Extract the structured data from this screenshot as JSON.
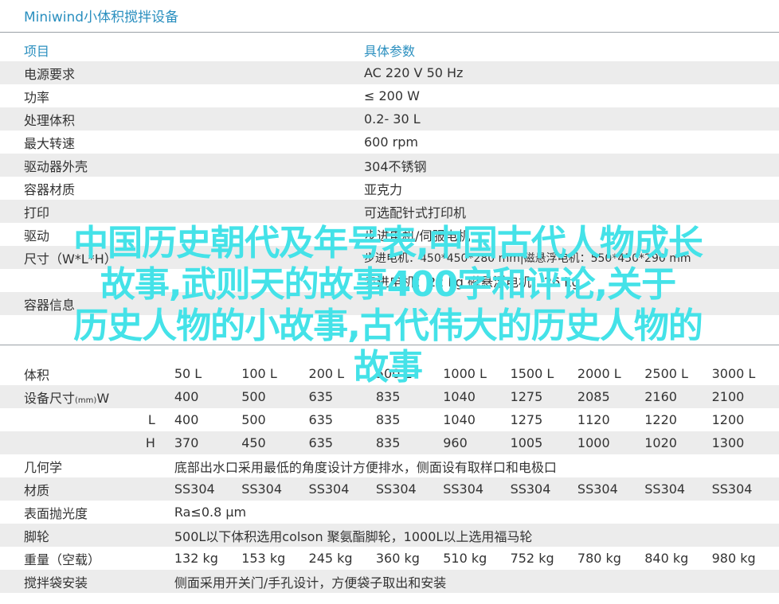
{
  "header": {
    "title": "Miniwind小体积搅拌设备"
  },
  "spec_table": {
    "headers": [
      "项目",
      "具体参数"
    ],
    "rows": [
      [
        "电源要求",
        "AC 220  V 50 Hz"
      ],
      [
        "功率",
        "≤ 200 W"
      ],
      [
        "处理体积",
        "0.2- 30 L"
      ],
      [
        "最大转速",
        "600  rpm"
      ],
      [
        "驱动器外壳",
        "304不锈钢"
      ],
      [
        "容器材质",
        "亚克力"
      ],
      [
        "打印",
        "可选配针式打印机"
      ]
    ],
    "partial_rows": [
      [
        "驱动",
        "步进电机/伺服电机"
      ],
      [
        "尺寸（W*L*H）",
        "步进电机：450*450*280 mm|磁悬浮电机：550*450*290 mm"
      ],
      [
        "",
        "步进电机：22 kg 磁悬浮电机：26 kg"
      ]
    ]
  },
  "section_label": "容器信息",
  "container_table": {
    "volume_label": "体积",
    "volumes": [
      "50 L",
      "100 L",
      "200 L",
      "500 L",
      "1000 L",
      "1500 L",
      "2000 L",
      "2500 L",
      "3000 L"
    ],
    "size_label": "设备尺寸",
    "size_unit": "(mm)",
    "W": {
      "label": "W",
      "values": [
        "400",
        "500",
        "635",
        "835",
        "1040",
        "1275",
        "2085",
        "2160",
        "2100"
      ]
    },
    "L": {
      "label": "L",
      "values": [
        "400",
        "500",
        "635",
        "835",
        "1040",
        "1275",
        "1120",
        "1220",
        "1200"
      ]
    },
    "H": {
      "label": "H",
      "values": [
        "370",
        "450",
        "635",
        "835",
        "960",
        "1005",
        "1000",
        "1020",
        "1300"
      ]
    },
    "geometry_label": "几何学",
    "geometry_value": "底部出水口采用最低的角度设计方便排水，侧面设有取样口和电极口",
    "material_label": "材质",
    "materials": [
      "SS304",
      "SS304",
      "SS304",
      "SS304",
      "SS304",
      "SS304",
      "SS304",
      "SS304",
      "SS304"
    ],
    "polish_label": "表面抛光度",
    "polish_value": "Ra≤0.8 μm",
    "wheel_label": "脚轮",
    "wheel_value": "500L以下体积选用colson 聚氨酯脚轮，1000L以上选用福马轮",
    "weight_label": "重量（空载）",
    "weights": [
      "132 kg",
      "153 kg",
      "245 kg",
      "360 kg",
      "510 kg",
      "752 kg",
      "780 kg",
      "840 kg",
      "980 kg"
    ],
    "bag_label": "搅拌袋安装",
    "bag_value": "侧面采用开关门/手孔设计，方便袋子取出和安装"
  },
  "overlay": {
    "lines": [
      "中国历史朝代及年号表,中国古代人物成长",
      "故事,武则天的故事400字和评论,关于",
      "历史人物的小故事,古代伟大的历史人物的",
      "故事"
    ],
    "color": "#44e2e8"
  },
  "colors": {
    "accent": "#2a8fbf",
    "stripe": "#ececec",
    "rule": "#9aa0a6"
  }
}
